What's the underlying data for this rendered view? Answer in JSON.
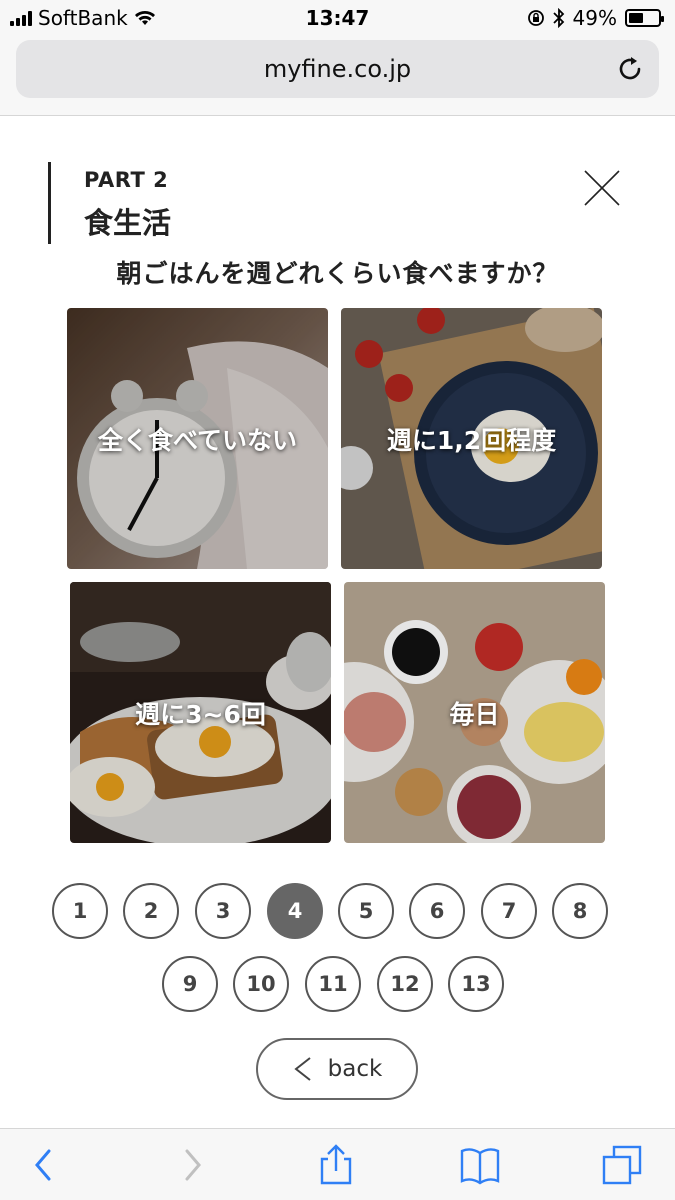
{
  "status_bar": {
    "carrier": "SoftBank",
    "time": "13:47",
    "battery_percent": "49%",
    "battery_level": 0.49
  },
  "browser": {
    "url": "myfine.co.jp"
  },
  "header": {
    "part": "PART 2",
    "title": "食生活"
  },
  "question": "朝ごはんを週どれくらい食べますか？",
  "options": [
    {
      "label": "全く食べていない"
    },
    {
      "label": "週に1,2回程度"
    },
    {
      "label": "週に3~6回"
    },
    {
      "label": "毎日"
    }
  ],
  "pagination": {
    "pages": [
      "1",
      "2",
      "3",
      "4",
      "5",
      "6",
      "7",
      "8",
      "9",
      "10",
      "11",
      "12",
      "13"
    ],
    "current": "4"
  },
  "back_label": "back",
  "colors": {
    "accent": "#666666",
    "text": "#222222",
    "toolbar_icon": "#2f7ff5"
  }
}
